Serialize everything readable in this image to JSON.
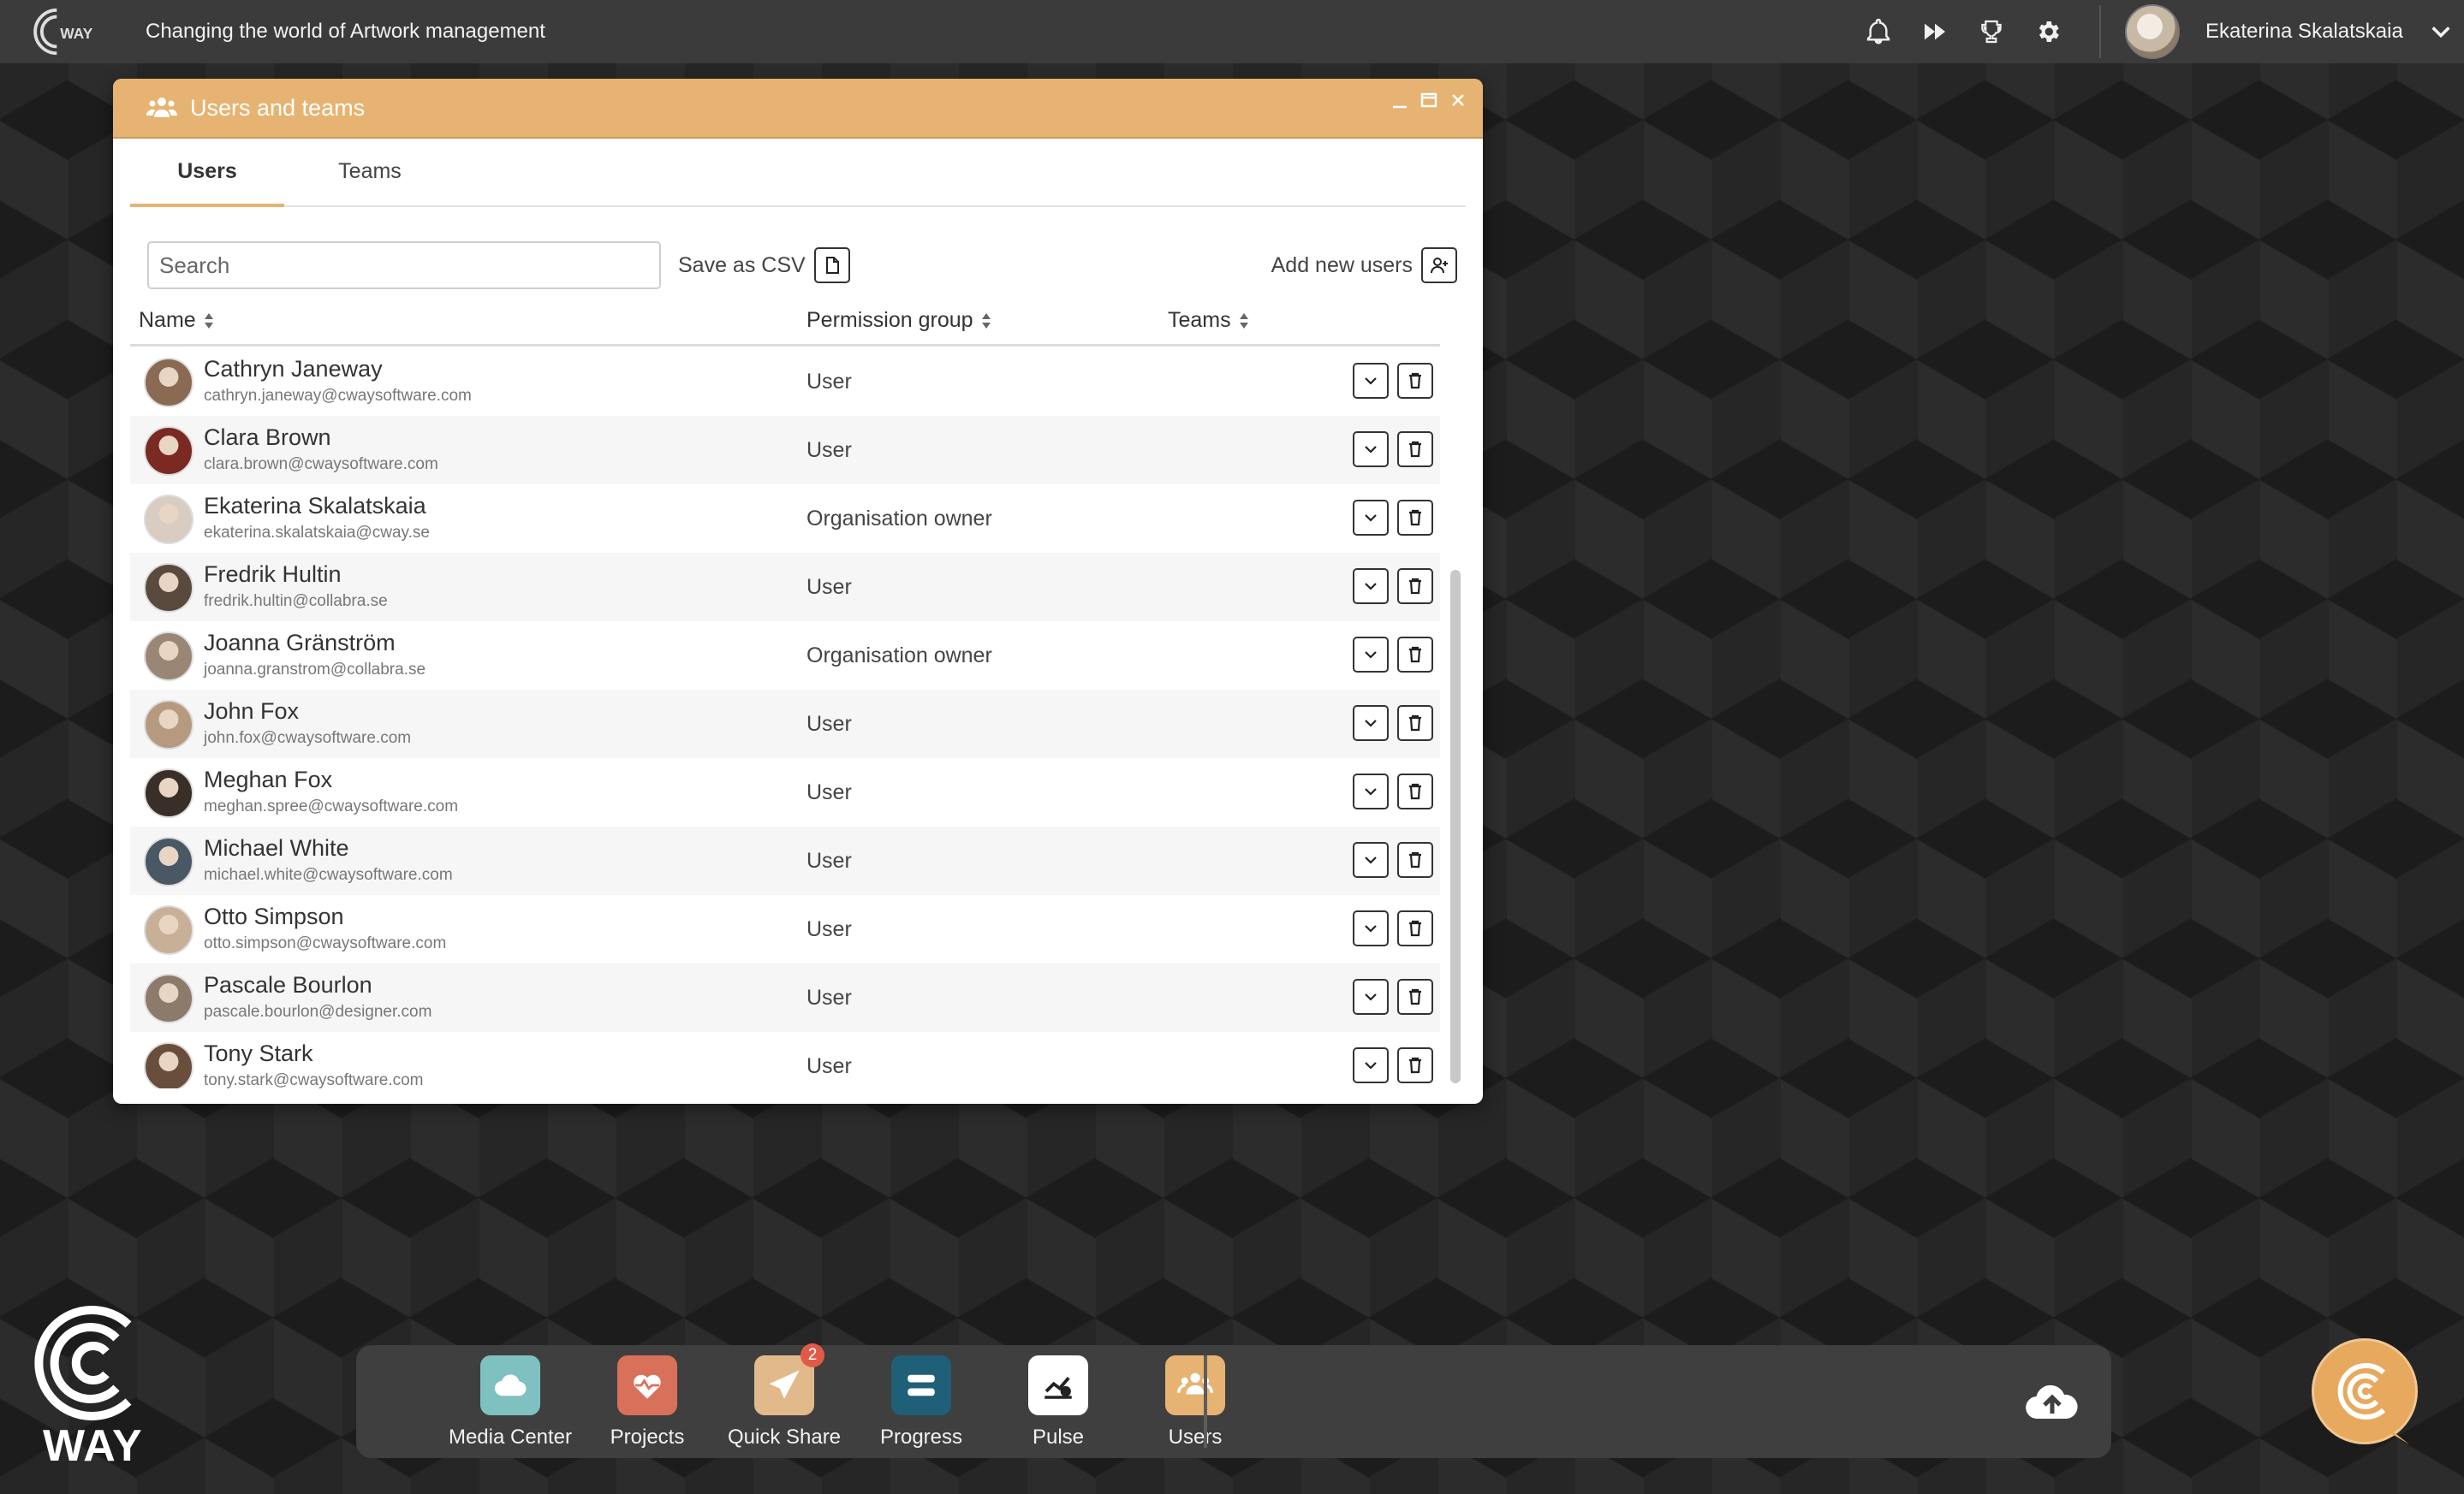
{
  "topbar": {
    "tagline": "Changing the world of Artwork management",
    "user_name": "Ekaterina Skalatskaia",
    "icons": [
      "bell-icon",
      "fast-forward-icon",
      "trophy-icon",
      "gear-icon"
    ]
  },
  "window": {
    "title": "Users and teams",
    "tabs": {
      "users": "Users",
      "teams": "Teams"
    },
    "search_placeholder": "Search",
    "save_csv": "Save as CSV",
    "add_users": "Add new users",
    "columns": {
      "name": "Name",
      "permission": "Permission group",
      "teams": "Teams"
    },
    "users": [
      {
        "name": "Cathryn Janeway",
        "email": "cathryn.janeway@cwaysoftware.com",
        "permission": "User",
        "avatar_color": "#8a6a52"
      },
      {
        "name": "Clara Brown",
        "email": "clara.brown@cwaysoftware.com",
        "permission": "User",
        "avatar_color": "#7a2a22"
      },
      {
        "name": "Ekaterina Skalatskaia",
        "email": "ekaterina.skalatskaia@cway.se",
        "permission": "Organisation owner",
        "avatar_color": "#d8cdc0"
      },
      {
        "name": "Fredrik Hultin",
        "email": "fredrik.hultin@collabra.se",
        "permission": "User",
        "avatar_color": "#5a4a3e"
      },
      {
        "name": "Joanna Gränström",
        "email": "joanna.granstrom@collabra.se",
        "permission": "Organisation owner",
        "avatar_color": "#9a8674"
      },
      {
        "name": "John Fox",
        "email": "john.fox@cwaysoftware.com",
        "permission": "User",
        "avatar_color": "#b59a80"
      },
      {
        "name": "Meghan Fox",
        "email": "meghan.spree@cwaysoftware.com",
        "permission": "User",
        "avatar_color": "#3a2e28"
      },
      {
        "name": "Michael White",
        "email": "michael.white@cwaysoftware.com",
        "permission": "User",
        "avatar_color": "#4a5866"
      },
      {
        "name": "Otto Simpson",
        "email": "otto.simpson@cwaysoftware.com",
        "permission": "User",
        "avatar_color": "#c8b098"
      },
      {
        "name": "Pascale Bourlon",
        "email": "pascale.bourlon@designer.com",
        "permission": "User",
        "avatar_color": "#8c7a6a"
      },
      {
        "name": "Tony Stark",
        "email": "tony.stark@cwaysoftware.com",
        "permission": "User",
        "avatar_color": "#6a4e3c"
      }
    ]
  },
  "logo": {
    "text": "WAY"
  },
  "dock": {
    "items": [
      {
        "label": "Media Center",
        "color": "#7ec1c0"
      },
      {
        "label": "Projects",
        "color": "#d9705a"
      },
      {
        "label": "Quick Share",
        "color": "#e2b98a",
        "badge": "2"
      },
      {
        "label": "Progress",
        "color": "#1f5f78"
      },
      {
        "label": "Pulse",
        "color": "#ffffff"
      },
      {
        "label": "Users",
        "color": "#e6b372"
      }
    ]
  },
  "colors": {
    "accent": "#e6b372",
    "topbar": "#3b3b3b"
  }
}
